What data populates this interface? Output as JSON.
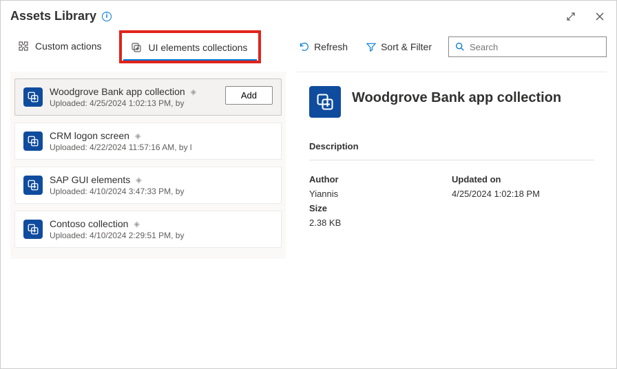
{
  "window": {
    "title": "Assets Library"
  },
  "tabs": {
    "custom_actions": "Custom actions",
    "ui_collections": "UI elements collections"
  },
  "toolbar": {
    "refresh": "Refresh",
    "sort_filter": "Sort & Filter",
    "search_placeholder": "Search"
  },
  "list": [
    {
      "title": "Woodgrove Bank app collection",
      "meta": "Uploaded: 4/25/2024 1:02:13 PM, by",
      "selected": true,
      "add": "Add"
    },
    {
      "title": "CRM logon screen",
      "meta": "Uploaded: 4/22/2024 11:57:16 AM, by l"
    },
    {
      "title": "SAP GUI elements",
      "meta": "Uploaded: 4/10/2024 3:47:33 PM, by"
    },
    {
      "title": "Contoso collection",
      "meta": "Uploaded: 4/10/2024 2:29:51 PM, by"
    }
  ],
  "details": {
    "title": "Woodgrove Bank app collection",
    "description_label": "Description",
    "author_label": "Author",
    "author": "Yiannis",
    "updated_label": "Updated on",
    "updated": "4/25/2024 1:02:18 PM",
    "size_label": "Size",
    "size": "2.38 KB"
  }
}
